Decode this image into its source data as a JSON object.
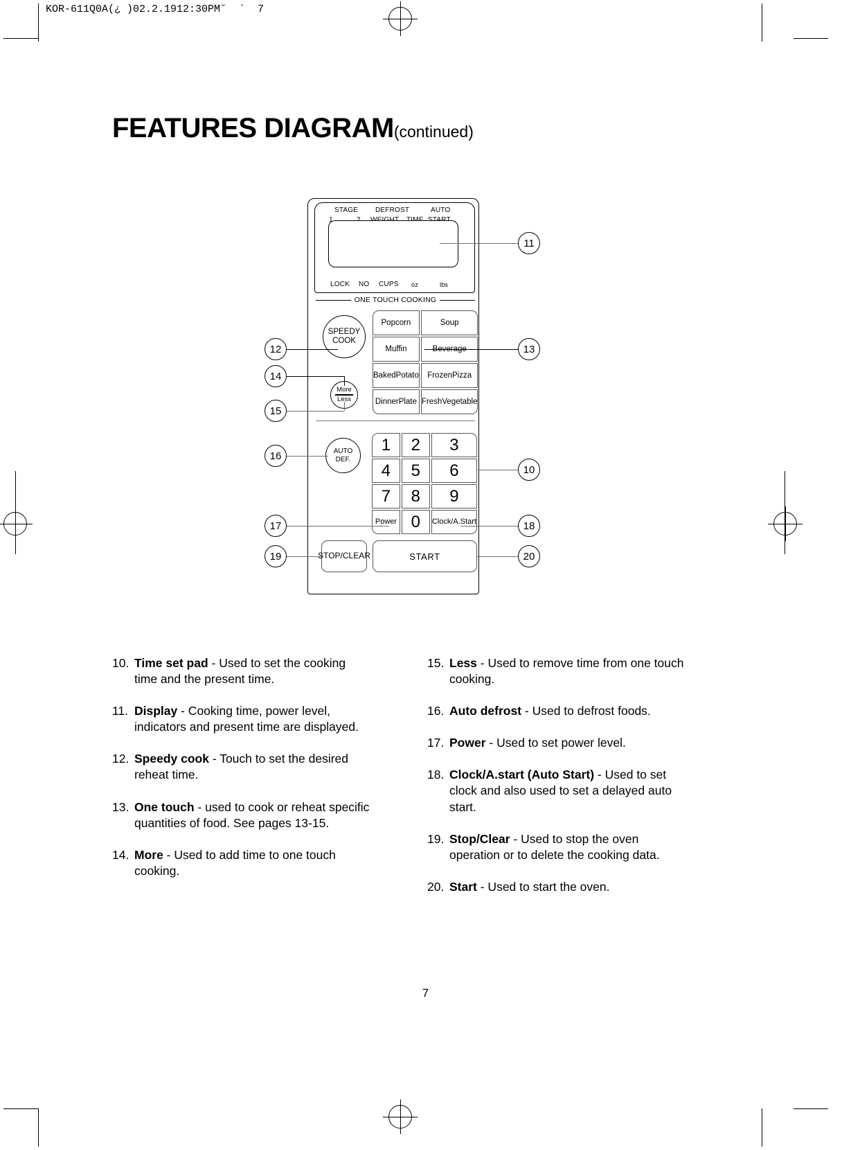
{
  "slug": "KOR-611Q0A(¿ )02.2.1912:30PM˘  `  7",
  "title": {
    "main": "FEATURES DIAGRAM",
    "continued": "(continued)"
  },
  "folio": "7",
  "panel": {
    "display": {
      "top_labels": [
        "STAGE",
        "1",
        "2",
        "DEFROST",
        "WEIGHT",
        "TIME",
        "AUTO",
        "START"
      ],
      "stage": "STAGE",
      "stage_1": "1",
      "stage_2": "2",
      "defrost": "DEFROST",
      "weight": "WEIGHT",
      "time": "TIME",
      "auto": "AUTO",
      "start": "START",
      "bottom_labels": [
        "LOCK",
        "NO",
        "CUPS",
        "oz",
        "lbs"
      ],
      "lock": "LOCK",
      "no": "NO",
      "cups": "CUPS",
      "oz": "oz",
      "lbs": "lbs"
    },
    "one_touch_band": "ONE TOUCH COOKING",
    "speedy_cook": {
      "line1": "SPEEDY",
      "line2": "COOK"
    },
    "more_less": {
      "more": "More",
      "less": "Less"
    },
    "auto_def": {
      "line1": "AUTO",
      "line2": "DEF."
    },
    "one_touch_keys": [
      "Popcorn",
      "Soup",
      "Muffin",
      "Beverage",
      "Baked\nPotato",
      "Frozen\nPizza",
      "Dinner\nPlate",
      "Fresh\nVegetable"
    ],
    "keypad": [
      "1",
      "2",
      "3",
      "4",
      "5",
      "6",
      "7",
      "8",
      "9"
    ],
    "power": "Power",
    "zero": "0",
    "clock_astart": "Clock/\nA.Start",
    "stop_clear": "STOP/\nCLEAR",
    "start": "START",
    "callouts": [
      "12",
      "14",
      "15",
      "16",
      "17",
      "19",
      "11",
      "13",
      "10",
      "18",
      "20"
    ]
  },
  "descriptions": {
    "left": [
      {
        "num": "10.",
        "term": "Time set pad",
        "text": " - Used to set the cooking time and the present time."
      },
      {
        "num": "11.",
        "term": "Display",
        "text": " - Cooking time, power level, indicators and present time are displayed."
      },
      {
        "num": "12.",
        "term": "Speedy cook",
        "text": " - Touch to set the desired reheat time."
      },
      {
        "num": "13.",
        "term": "One touch",
        "text": " - used to cook or reheat specific quantities of food. See pages 13-15."
      },
      {
        "num": "14.",
        "term": "More",
        "text": " - Used to add time to one touch cooking."
      }
    ],
    "right": [
      {
        "num": "15.",
        "term": "Less",
        "text": " - Used to remove time from one touch cooking."
      },
      {
        "num": "16.",
        "term": "Auto defrost",
        "text": " - Used to defrost foods."
      },
      {
        "num": "17.",
        "term": "Power",
        "text": " - Used to set power level."
      },
      {
        "num": "18.",
        "term": "Clock/A.start (Auto Start)",
        "text": " - Used to set clock and also used to set a delayed auto start."
      },
      {
        "num": "19.",
        "term": "Stop/Clear",
        "text": " - Used to stop the oven operation or to delete the cooking data."
      },
      {
        "num": "20.",
        "term": "Start",
        "text": " - Used to start the oven."
      }
    ]
  }
}
